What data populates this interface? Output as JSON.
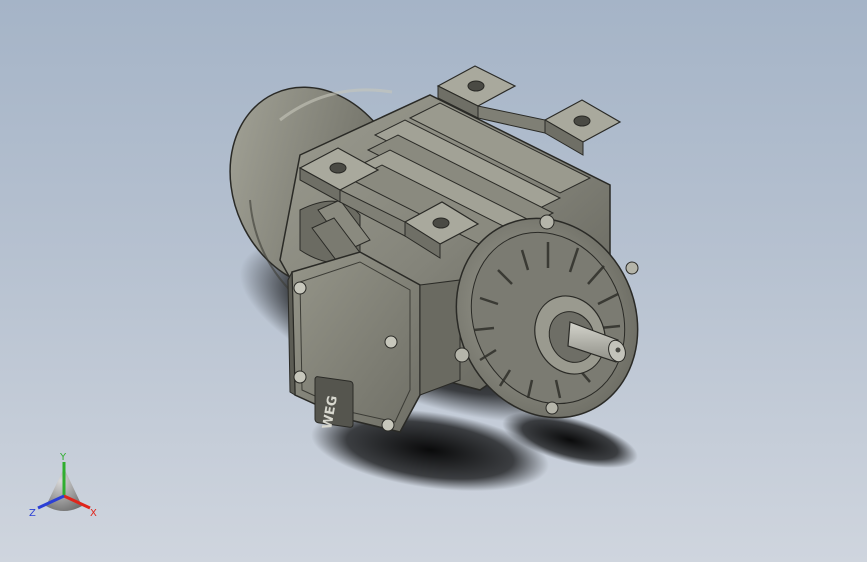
{
  "viewport": {
    "background_top": "#a5b4c7",
    "background_bottom": "#cfd5de"
  },
  "model": {
    "subject": "electric-motor-3d-model",
    "body_color": "#8f8f83",
    "shadow_color": "#000000",
    "nameplate_text": "WEG"
  },
  "triad": {
    "x_label": "X",
    "y_label": "Y",
    "z_label": "Z",
    "x_color": "#e0251b",
    "y_color": "#2fae2f",
    "z_color": "#2b3fd6"
  }
}
